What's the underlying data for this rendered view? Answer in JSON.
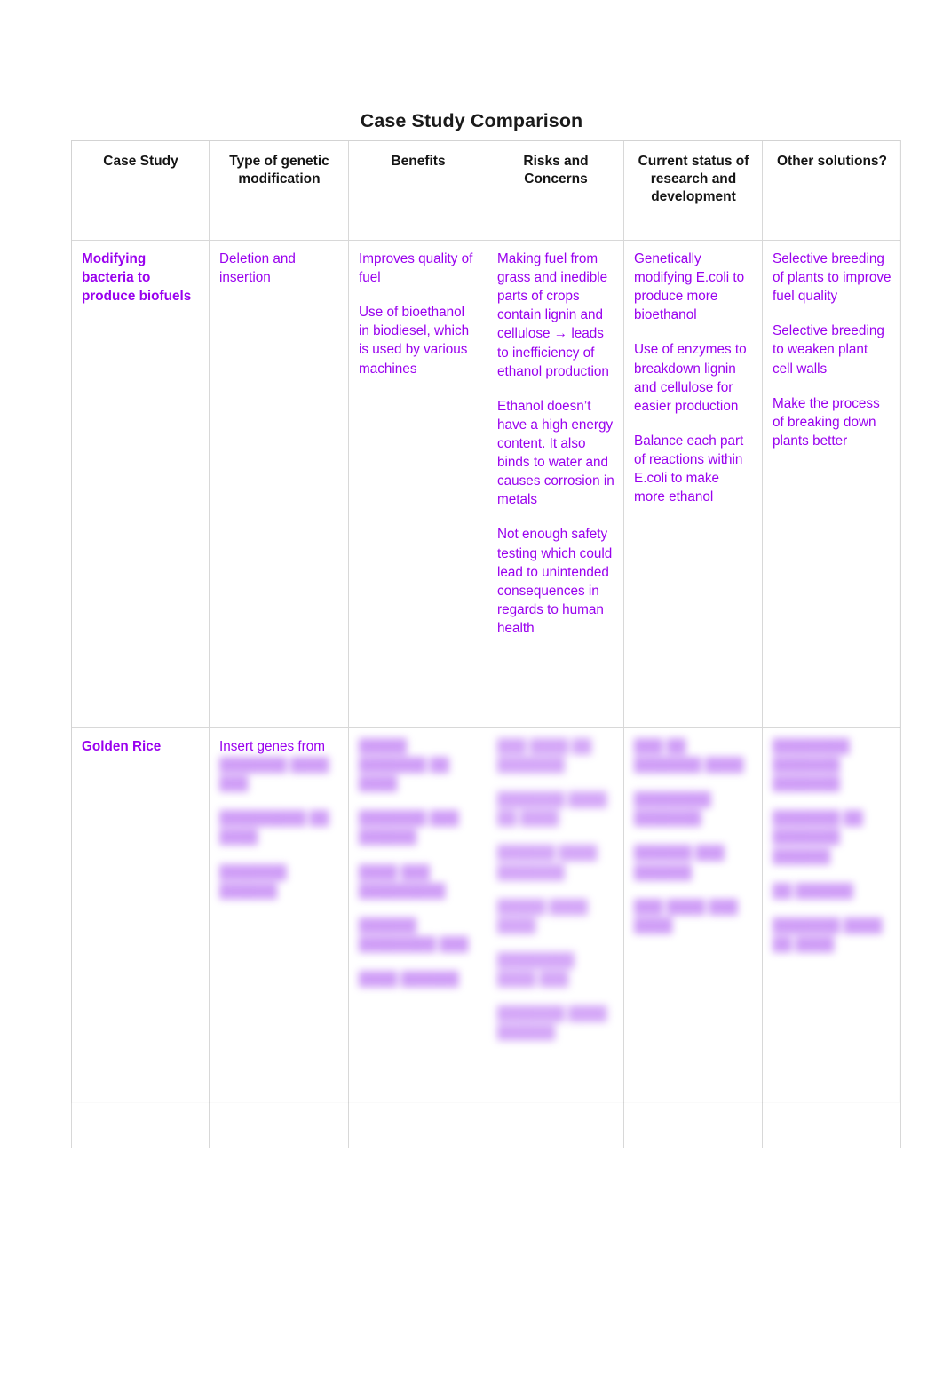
{
  "document": {
    "title": "Case Study Comparison"
  },
  "table": {
    "columns": [
      {
        "key": "case_study",
        "label": "Case Study"
      },
      {
        "key": "type_of_modification",
        "label": "Type of genetic modification"
      },
      {
        "key": "benefits",
        "label": "Benefits"
      },
      {
        "key": "risks_and_concerns",
        "label": "Risks and Concerns"
      },
      {
        "key": "current_status",
        "label": "Current status of research and development"
      },
      {
        "key": "other_solutions",
        "label": "Other solutions?"
      }
    ],
    "rows": [
      {
        "id": "modifying-bacteria-to-produce-biofuels",
        "legible": true,
        "case_study": "Modifying bacteria to produce biofuels",
        "type_of_modification": [
          "Deletion and insertion"
        ],
        "benefits": [
          "Improves quality of fuel",
          "Use of bioethanol in biodiesel, which is used by various machines"
        ],
        "risks_and_concerns": [
          "Making fuel from grass and inedible parts of crops contain lignin and cellulose → leads to inefficiency of ethanol production",
          "Ethanol doesn’t have a high energy content. It also binds to water and causes corrosion in metals",
          "Not enough safety testing which could lead to unintended consequences in regards to human health"
        ],
        "current_status": [
          "Genetically modifying E.coli to produce more bioethanol",
          "Use of enzymes to breakdown lignin and cellulose for easier production",
          "Balance each part of reactions within E.coli to make more ethanol"
        ],
        "other_solutions": [
          "Selective breeding of plants to improve fuel quality",
          "Selective breeding to weaken plant cell walls",
          "Make the process of breaking down plants better"
        ]
      },
      {
        "id": "golden-rice",
        "legible": false,
        "redaction_note": "Body text in this row is blurred and illegible in the source image.",
        "case_study": "Golden Rice",
        "type_of_modification_visible": "Insert genes from",
        "type_of_modification_redacted": [
          "███████ ████ ███",
          "█████████ ██ ████",
          "███████ ██████"
        ],
        "benefits_redacted": [
          "█████ ███████ ██ ████",
          "███████ ███ ██████",
          "████ ███ █████████",
          "██████ ████████ ███",
          "████ ██████",
          "███████ ████ ████",
          "██████ ███ ███████",
          "███████ ██ █████",
          "████████"
        ],
        "risks_and_concerns_redacted": [
          "███ ████ ██ ███████",
          "███████ ████ ██ ████",
          "██████ ████ ███████",
          "█████ ████ ████",
          "████████ ████ ███",
          "███████ ████ ██████",
          "█████ ███████ ████",
          "██████ ████ █████",
          "██████ ██ ████ ███",
          "███████ ████",
          "████████ ██ ████",
          "██████",
          "███████ ██ ██████",
          "████ ████ ███ ████"
        ],
        "current_status_redacted": [
          "███ ██ ███████ ████",
          "████████ ███████",
          "██████ ███ ██████",
          "███ ████ ███ ████",
          "██ █████████",
          "██████ ████ ██████",
          "███████ ███ █████",
          "████ ████ ██████",
          "██████ ██ ███████",
          "██ ████████"
        ],
        "other_solutions_redacted": [
          "████████ ███████ ███████",
          "███████ ██ ███████ ██████",
          "██ ██████",
          "███████ ████ ██ ████",
          "███████ ███ ███████",
          "█████ ██████ ████",
          "███████ ██████ ████"
        ]
      }
    ]
  },
  "colors": {
    "body_text_purple": "#9900ee",
    "heading_black": "#141414",
    "border_gray": "#d8d8d8",
    "page_background": "#ffffff"
  }
}
